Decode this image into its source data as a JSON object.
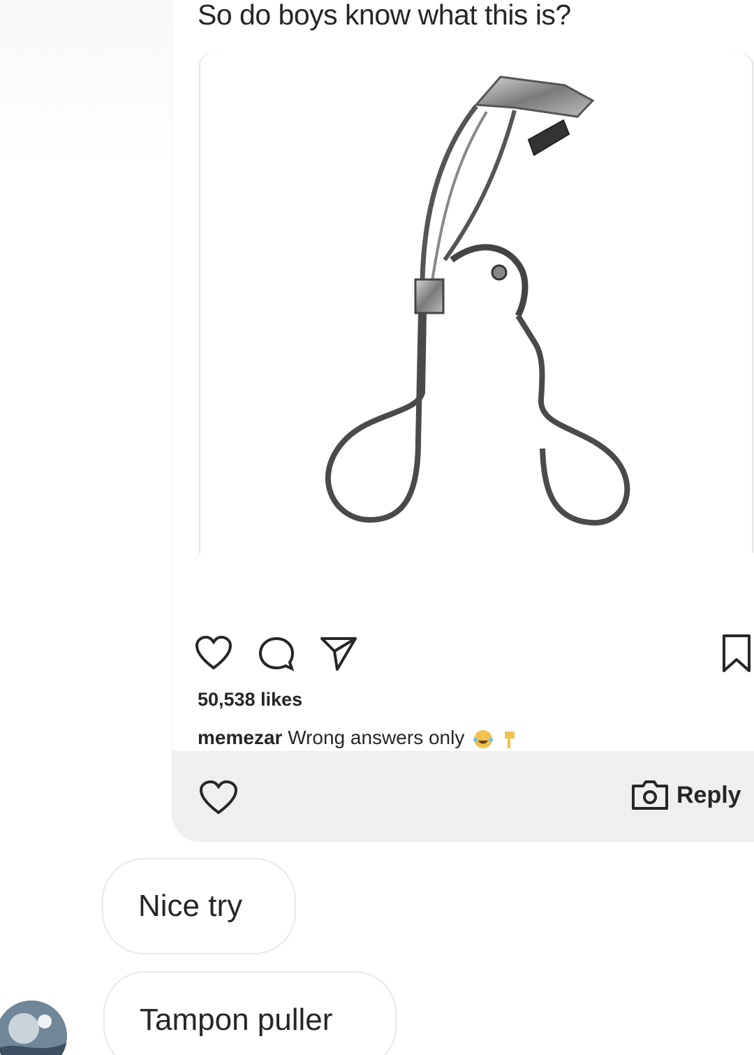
{
  "post": {
    "title": "So do boys know what this is?",
    "likes": "50,538 likes",
    "caption_user": "memezar",
    "caption_text": "Wrong answers only",
    "caption_emojis": [
      "face-with-tears-of-joy-icon",
      "pointing-down-icon"
    ]
  },
  "reply_bar": {
    "reply_label": "Reply"
  },
  "messages": [
    {
      "text": "Nice try"
    },
    {
      "text": "Tampon puller"
    }
  ],
  "colors": {
    "text": "#262626",
    "bubble_border": "#e8e8e8",
    "reply_bar_bg": "#efefef"
  }
}
